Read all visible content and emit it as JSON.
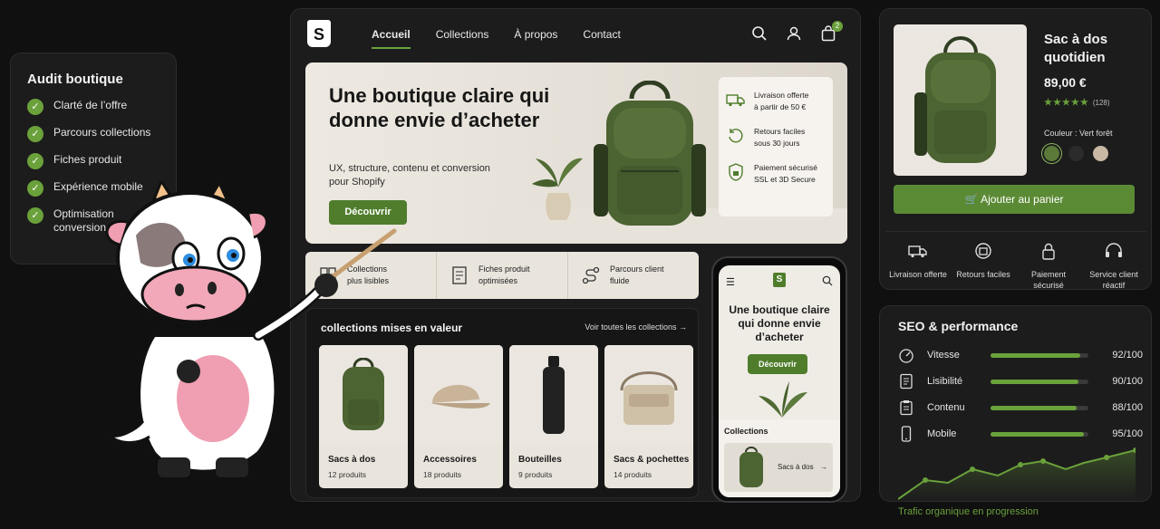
{
  "audit": {
    "title": "Audit boutique",
    "items": [
      "Clarté de l’offre",
      "Parcours collections",
      "Fiches produit",
      "Expérience mobile",
      "Optimisation conversion"
    ]
  },
  "nav": {
    "links": [
      "Accueil",
      "Collections",
      "À propos",
      "Contact"
    ],
    "active": "Accueil",
    "cart_count": "2"
  },
  "hero": {
    "title": "Une boutique claire qui donne envie d’acheter",
    "subtitle": "UX, structure, contenu et conversion pour Shopify",
    "cta": "Découvrir",
    "features": [
      {
        "title": "Livraison offerte",
        "sub": "à partir de 50 €"
      },
      {
        "title": "Retours faciles",
        "sub": "sous 30 jours"
      },
      {
        "title": "Paiement sécurisé",
        "sub": "SSL et 3D Secure"
      }
    ]
  },
  "highlights": [
    {
      "title": "Collections",
      "sub": "plus lisibles"
    },
    {
      "title": "Fiches produit",
      "sub": "optimisées"
    },
    {
      "title": "Parcours client",
      "sub": "fluide"
    }
  ],
  "collections": {
    "heading": "collections mises en valeur",
    "see_all": "Voir toutes les collections",
    "cards": [
      {
        "title": "Sacs à dos",
        "count": "12 produits"
      },
      {
        "title": "Accessoires",
        "count": "18 produits"
      },
      {
        "title": "Bouteilles",
        "count": "9 produits"
      },
      {
        "title": "Sacs & pochettes",
        "count": "14 produits"
      }
    ]
  },
  "mobile": {
    "title": "Une boutique claire qui donne envie d’acheter",
    "cta": "Découvrir",
    "collections_title": "Collections",
    "card_label": "Sacs à dos"
  },
  "product": {
    "title": "Sac à dos quotidien",
    "price": "89,00 €",
    "stars": "★★★★★",
    "reviews": "(128)",
    "color_label": "Couleur : Vert forêt",
    "swatches": [
      "#5b7a3a",
      "#2b2b2b",
      "#c8b8a4"
    ],
    "add_to_cart": "Ajouter au panier",
    "services": [
      {
        "icon": "truck-icon",
        "label": "Livraison offerte"
      },
      {
        "icon": "return-box-icon",
        "label": "Retours faciles"
      },
      {
        "icon": "lock-icon",
        "label": "Paiement sécurisé"
      },
      {
        "icon": "headset-icon",
        "label": "Service client réactif"
      }
    ]
  },
  "seo": {
    "title": "SEO & performance",
    "metrics": [
      {
        "label": "Vitesse",
        "value": "92/100",
        "score": 92
      },
      {
        "label": "Lisibilité",
        "value": "90/100",
        "score": 90
      },
      {
        "label": "Contenu",
        "value": "88/100",
        "score": 88
      },
      {
        "label": "Mobile",
        "value": "95/100",
        "score": 95
      }
    ],
    "traffic_label": "Trafic organique en progression"
  },
  "colors": {
    "accent": "#6aa13b",
    "button": "#4f7d2c",
    "background": "#101010"
  }
}
